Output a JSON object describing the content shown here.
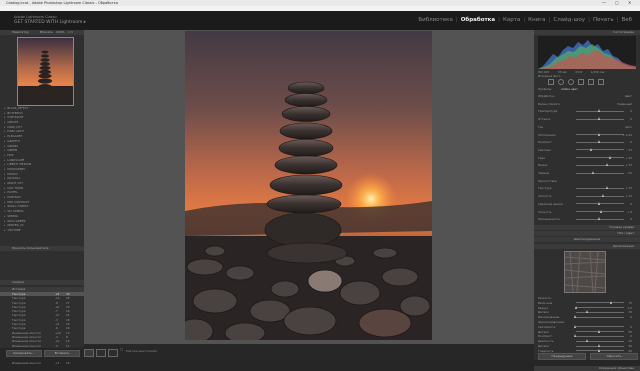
{
  "window": {
    "title": "Catalog.lrcat - Adobe Photoshop Lightroom Classic - Обработка",
    "minimize_glyph": "—",
    "maximize_glyph": "▢",
    "close_glyph": "✕"
  },
  "menu": [
    "Файл",
    "Правка",
    "Обработка",
    "Фото",
    "Настройки",
    "Инструменты",
    "Вид",
    "Окно",
    "Справка"
  ],
  "identity": {
    "line1": "Adobe Lightroom Classic",
    "line2": "GET STARTED WITH Lightroom ▸"
  },
  "modules": [
    "Библиотека",
    "Обработка",
    "Карта",
    "Книга",
    "Слайд-шоу",
    "Печать",
    "Веб"
  ],
  "active_module": "Обработка",
  "left_panel": {
    "navigator_header": "Навигатор",
    "navigator_zoom": [
      "Вписать",
      "100%",
      "1:3"
    ],
    "folders": [
      "BLACK_EFFECT",
      "BUTTERFLY",
      "COPYRIGHT",
      "CREATE",
      "DARK CITY",
      "DARK ARCH",
      "ELEGANTE",
      "GRAFFITI",
      "GRAINS",
      "GREEN",
      "HDR",
      "LANDSCAPE",
      "LIBERTY MEDIUM",
      "MIDJOURNEY",
      "MOODY",
      "NATURAL",
      "NIGHT CITY",
      "OLD TOWN",
      "PASTEL",
      "PORTRAIT",
      "PRO CONTRAST",
      "SMALL FOREST",
      "SKI CINEMA",
      "SPRING",
      "WILD GREEN",
      "WINTER_VII",
      "YOUTUBE"
    ],
    "presets_footer": "Пресеты пользователя",
    "snapshots_header": "Снимки",
    "history_header": "История",
    "history": [
      {
        "name": "Текстура",
        "v1": "+8",
        "v2": "33"
      },
      {
        "name": "Текстура",
        "v1": "-14",
        "v2": "25"
      },
      {
        "name": "Текстура",
        "v1": "-8",
        "v2": "17"
      },
      {
        "name": "Текстура",
        "v1": "+6",
        "v2": "23"
      },
      {
        "name": "Текстура",
        "v1": "-7",
        "v2": "16"
      },
      {
        "name": "Текстура",
        "v1": "+5",
        "v2": "21"
      },
      {
        "name": "Текстура",
        "v1": "-3",
        "v2": "18"
      },
      {
        "name": "Текстура",
        "v1": "+4",
        "v2": "22"
      },
      {
        "name": "Текстура",
        "v1": "-6",
        "v2": "16"
      },
      {
        "name": "Изменение ясности",
        "v1": "+10",
        "v2": "12"
      },
      {
        "name": "Изменение ясности",
        "v1": "-4",
        "v2": "8"
      },
      {
        "name": "Изменение ясности",
        "v1": "+6",
        "v2": "14"
      },
      {
        "name": "Изменение ясности",
        "v1": "-3",
        "v2": "11"
      },
      {
        "name": "Изменение ясности",
        "v1": "+2",
        "v2": "13"
      },
      {
        "name": "Изменение ясности",
        "v1": "-5",
        "v2": "8"
      },
      {
        "name": "Изменение ясности",
        "v1": "+4",
        "v2": "12"
      },
      {
        "name": "Изменение ясности",
        "v1": "+3",
        "v2": "15"
      }
    ],
    "copy_button": "Копировать...",
    "paste_button": "Вставить"
  },
  "toolbar": {
    "softproof_label": "Мягкая цветопроба",
    "softproof_check": "☐"
  },
  "right_panel": {
    "histogram_header": "Гистограмма",
    "camera_info": [
      "ISO 100",
      "35 мм",
      "f/2,8",
      "1/250 сек"
    ],
    "original_label": "Исходное фото",
    "profile_label": "Профиль:",
    "profile_value": "Adobe цвет",
    "basic": [
      {
        "label": "Обработка:",
        "value": "Цвет"
      },
      {
        "label": "Баланс белого:",
        "value": "Заданный"
      },
      {
        "label": "Температура",
        "value": "0"
      },
      {
        "label": "Оттенок",
        "value": "0"
      },
      {
        "label": "Тон",
        "value": "Авто"
      },
      {
        "label": "Экспозиция",
        "value": "+ 0,10"
      },
      {
        "label": "Контраст",
        "value": "0"
      },
      {
        "label": "Светлые",
        "value": "- 33"
      },
      {
        "label": "Тени",
        "value": "+ 45"
      },
      {
        "label": "Белые",
        "value": "+ 33"
      },
      {
        "label": "Черные",
        "value": "- 25"
      },
      {
        "label": "Присутствие",
        "value": ""
      },
      {
        "label": "Текстура",
        "value": "+ 33"
      },
      {
        "label": "Четкость",
        "value": "+ 15"
      },
      {
        "label": "Удаление дымки",
        "value": "0"
      },
      {
        "label": "Сочность",
        "value": "+ 8"
      },
      {
        "label": "Насыщенность",
        "value": "0"
      }
    ],
    "sections": [
      "Тоновая кривая",
      "HSL / Цвет",
      "Цветокоррекция",
      "Детализация"
    ],
    "sharpen": [
      {
        "label": "Резкость",
        "value": ""
      },
      {
        "label": "Величина",
        "value": "75"
      },
      {
        "label": "Радиус",
        "value": "1,0"
      },
      {
        "label": "Детали",
        "value": "25"
      },
      {
        "label": "Маскирование",
        "value": "0"
      },
      {
        "label": "Шумоподавление",
        "value": ""
      },
      {
        "label": "Светимость",
        "value": "0"
      },
      {
        "label": "Детали",
        "value": "50"
      },
      {
        "label": "Контраст",
        "value": "0"
      },
      {
        "label": "Цветность",
        "value": "25"
      },
      {
        "label": "Детали",
        "value": "50"
      },
      {
        "label": "Гладкость",
        "value": "50"
      }
    ],
    "lens_section": "Коррекция объектива",
    "prev_button": "Предыдущие",
    "reset_button": "Сбросить"
  }
}
